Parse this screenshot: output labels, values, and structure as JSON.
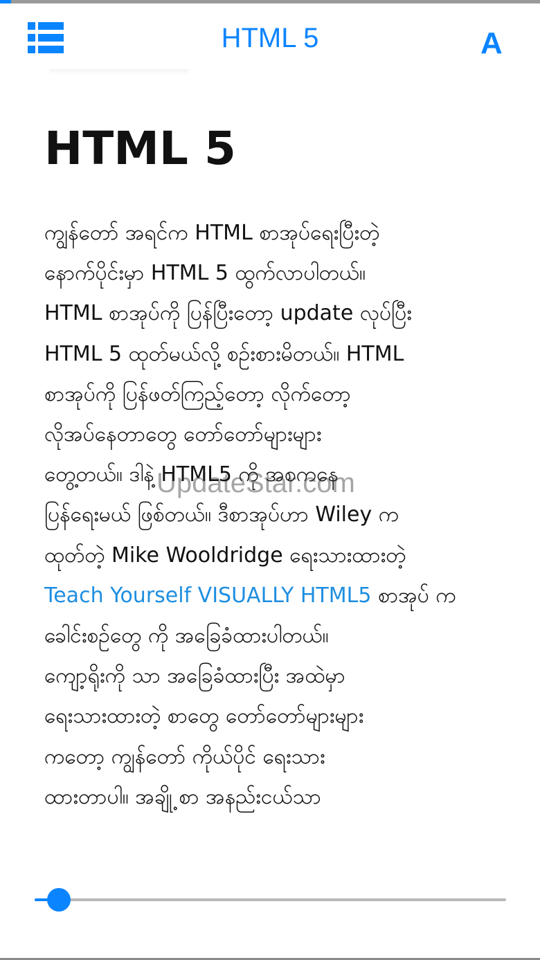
{
  "header": {
    "menu_icon": "list-menu-icon",
    "title": "HTML 5",
    "font_button_label": "A"
  },
  "article": {
    "heading": "HTML 5",
    "lines": [
      "ကျွန်တော် အရင်က HTML စာအုပ်ရေးပြီးတဲ့",
      "နောက်ပိုင်းမှာ HTML 5 ထွက်လာပါတယ်။",
      "HTML စာအုပ်ကို ပြန်ပြီးတော့ update လုပ်ပြီး",
      "HTML 5 ထုတ်မယ်လို့ စဉ်းစားမိတယ်။ HTML",
      "စာအုပ်ကို ပြန်ဖတ်ကြည့်တော့ လိုက်တော့",
      "လိုအပ်နေတာတွေ တော်တော်များများ",
      "တွေ့တယ်။ ဒါနဲ့ HTML5 ကို အစကနေ",
      "ပြန်ရေးမယ် ဖြစ်တယ်။ ဒီစာအုပ်ဟာ Wiley က",
      "ထုတ်တဲ့ Mike Wooldridge ရေးသားထားတဲ့"
    ],
    "link_text": "Teach Yourself VISUALLY HTML5",
    "link_suffix": " စာအုပ် က",
    "lines_after": [
      "ခေါင်းစဉ်တွေ ကို အခြေခံထားပါတယ်။",
      "ကျော့ရိုးကို သာ အခြေခံထားပြီး အထဲမှာ",
      "ရေးသားထားတဲ့ စာတွေ တော်တော်များများ",
      "ကတော့ ကျွန်တော် ကိုယ်ပိုင် ရေးသား",
      "ထားတာပါ။ အချို့ စာ အနည်းငယ်သာ"
    ]
  },
  "watermark": "UpdateStar.com",
  "progress": {
    "fraction": 0.035
  },
  "colors": {
    "accent": "#0a84ff",
    "link": "#1e8ee0",
    "track": "#b8b8b8"
  }
}
